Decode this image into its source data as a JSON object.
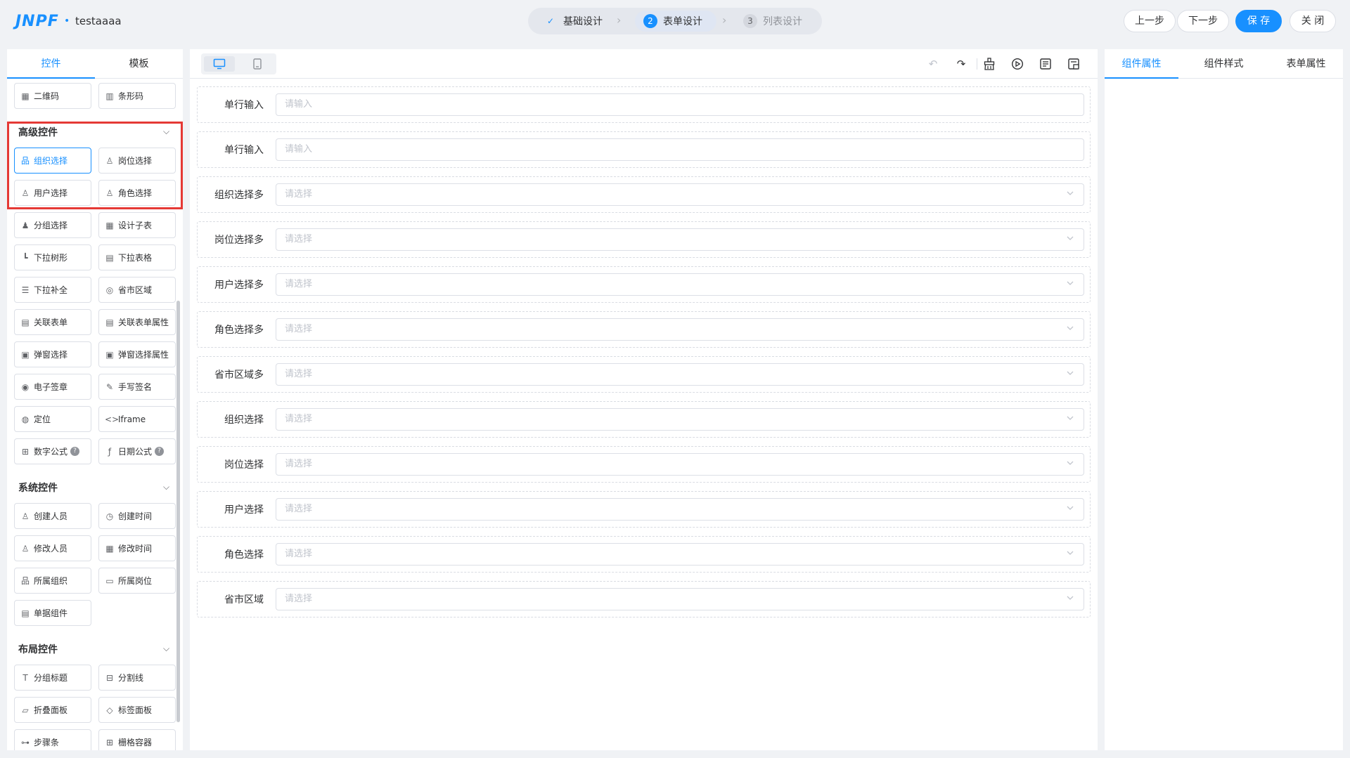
{
  "header": {
    "logo": {
      "main": "JNPF"
    },
    "app_name": "testaaaa",
    "steps": [
      {
        "index": "✓",
        "label": "基础设计",
        "state": "done"
      },
      {
        "index": "2",
        "label": "表单设计",
        "state": "active"
      },
      {
        "index": "3",
        "label": "列表设计",
        "state": "pending"
      }
    ],
    "buttons": {
      "prev": "上一步",
      "next": "下一步",
      "save": "保 存",
      "close": "关 闭"
    }
  },
  "left": {
    "tabs": [
      "控件",
      "模板"
    ],
    "top_items": [
      {
        "label": "二维码",
        "icon": "qrcode-icon"
      },
      {
        "label": "条形码",
        "icon": "barcode-icon"
      }
    ],
    "sections": {
      "advanced": "高级控件",
      "system": "系统控件",
      "layout": "布局控件"
    },
    "advanced_items": [
      {
        "label": "组织选择",
        "icon": "org-icon"
      },
      {
        "label": "岗位选择",
        "icon": "position-icon"
      },
      {
        "label": "用户选择",
        "icon": "user-icon"
      },
      {
        "label": "角色选择",
        "icon": "role-icon"
      },
      {
        "label": "分组选择",
        "icon": "group-icon"
      },
      {
        "label": "设计子表",
        "icon": "table-icon"
      },
      {
        "label": "下拉树形",
        "icon": "tree-icon"
      },
      {
        "label": "下拉表格",
        "icon": "grid-icon"
      },
      {
        "label": "下拉补全",
        "icon": "autocomplete-icon"
      },
      {
        "label": "省市区域",
        "icon": "area-icon"
      },
      {
        "label": "关联表单",
        "icon": "form-icon"
      },
      {
        "label": "关联表单属性",
        "icon": "form-attr-icon"
      },
      {
        "label": "弹窗选择",
        "icon": "popup-icon"
      },
      {
        "label": "弹窗选择属性",
        "icon": "popup-attr-icon"
      },
      {
        "label": "电子签章",
        "icon": "seal-icon"
      },
      {
        "label": "手写签名",
        "icon": "pen-icon"
      },
      {
        "label": "定位",
        "icon": "location-icon"
      },
      {
        "label": "Iframe",
        "icon": "code-icon"
      },
      {
        "label": "数字公式",
        "icon": "calc-icon",
        "help": "?"
      },
      {
        "label": "日期公式",
        "icon": "fx-icon",
        "help": "?"
      }
    ],
    "system_items": [
      {
        "label": "创建人员",
        "icon": "user-add-icon"
      },
      {
        "label": "创建时间",
        "icon": "clock-icon"
      },
      {
        "label": "修改人员",
        "icon": "user-edit-icon"
      },
      {
        "label": "修改时间",
        "icon": "calendar-icon"
      },
      {
        "label": "所属组织",
        "icon": "org-icon"
      },
      {
        "label": "所属岗位",
        "icon": "post-icon"
      },
      {
        "label": "单据组件",
        "icon": "bill-icon"
      }
    ],
    "layout_items": [
      {
        "label": "分组标题",
        "icon": "text-icon"
      },
      {
        "label": "分割线",
        "icon": "divider-icon"
      },
      {
        "label": "折叠面板",
        "icon": "collapse-icon"
      },
      {
        "label": "标签面板",
        "icon": "tag-icon"
      },
      {
        "label": "步骤条",
        "icon": "steps-icon"
      },
      {
        "label": "栅格容器",
        "icon": "layout-grid-icon"
      }
    ]
  },
  "form_rows": [
    {
      "label": "单行输入",
      "placeholder": "请输入",
      "type": "input"
    },
    {
      "label": "单行输入",
      "placeholder": "请输入",
      "type": "input"
    },
    {
      "label": "组织选择多",
      "placeholder": "请选择",
      "type": "select"
    },
    {
      "label": "岗位选择多",
      "placeholder": "请选择",
      "type": "select"
    },
    {
      "label": "用户选择多",
      "placeholder": "请选择",
      "type": "select"
    },
    {
      "label": "角色选择多",
      "placeholder": "请选择",
      "type": "select"
    },
    {
      "label": "省市区域多",
      "placeholder": "请选择",
      "type": "select"
    },
    {
      "label": "组织选择",
      "placeholder": "请选择",
      "type": "select"
    },
    {
      "label": "岗位选择",
      "placeholder": "请选择",
      "type": "select"
    },
    {
      "label": "用户选择",
      "placeholder": "请选择",
      "type": "select"
    },
    {
      "label": "角色选择",
      "placeholder": "请选择",
      "type": "select"
    },
    {
      "label": "省市区域",
      "placeholder": "请选择",
      "type": "select"
    }
  ],
  "right": {
    "tabs": [
      "组件属性",
      "组件样式",
      "表单属性"
    ]
  },
  "colors": {
    "accent": "#1890ff",
    "highlight": "#e53935"
  }
}
